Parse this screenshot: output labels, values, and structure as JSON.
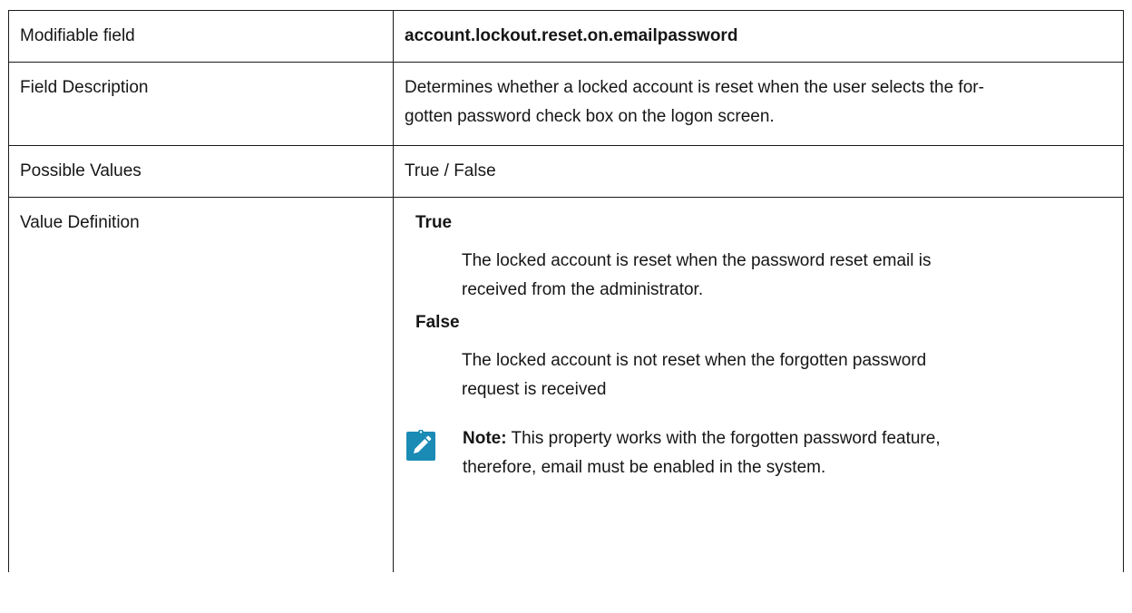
{
  "table": {
    "rows": {
      "modifiable_field": {
        "label": "Modifiable field",
        "value": "account.lockout.reset.on.emailpassword"
      },
      "field_description": {
        "label": "Field Description",
        "value_line1": "Determines whether a locked account is reset when the user selects the for-",
        "value_line2": "gotten password check box on the logon screen."
      },
      "possible_values": {
        "label": "Possible Values",
        "value": "True / False"
      },
      "value_definition": {
        "label": "Value Definition",
        "entries": [
          {
            "term": "True",
            "def_line1": "The locked account is reset when the password reset email is",
            "def_line2": "received from the administrator."
          },
          {
            "term": "False",
            "def_line1": "The locked account is not reset when the forgotten password",
            "def_line2": "request is received"
          }
        ],
        "note": {
          "icon": "pencil-note-icon",
          "label": "Note:",
          "text_line1": " This property works with the forgotten password feature,",
          "text_line2": "therefore, email must be enabled in the system."
        }
      }
    }
  },
  "colors": {
    "note_icon_bg": "#1a8bb5",
    "note_icon_fg": "#ffffff",
    "text": "#161616",
    "border": "#1a1a1a"
  }
}
